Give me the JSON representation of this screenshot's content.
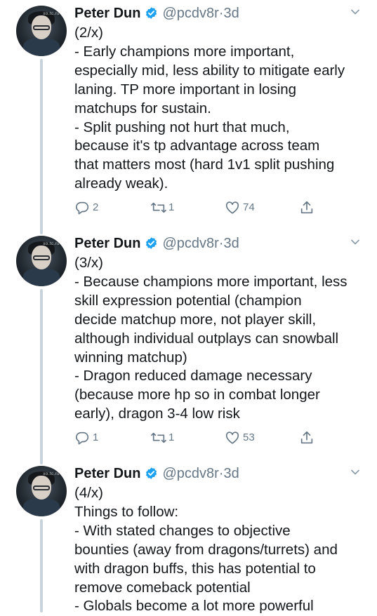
{
  "author": {
    "name": "Peter Dun",
    "handle": "@pcdv8r",
    "time_sep": "·",
    "avatar_tag": "xo.tc.ru"
  },
  "tweets": [
    {
      "time": "3d",
      "lines": [
        "(2/x)",
        "- Early champions more important,",
        "especially mid, less ability to mitigate early",
        "laning. TP more important in losing",
        "matchups for sustain.",
        "- Split pushing not hurt that much,",
        "because it's tp advantage across team",
        "that matters most (hard 1v1 split pushing",
        "already weak)."
      ],
      "replies": "2",
      "retweets": "1",
      "likes": "74"
    },
    {
      "time": "3d",
      "lines": [
        "(3/x)",
        "- Because champions more important, less",
        "skill expression potential (champion",
        "decide matchup more, not player skill,",
        "although individual outplays can snowball",
        "winning matchup)",
        "- Dragon reduced damage necessary",
        "(because more hp so in combat longer",
        "early), dragon 3-4 low risk"
      ],
      "replies": "1",
      "retweets": "1",
      "likes": "53"
    },
    {
      "time": "3d",
      "lines": [
        "(4/x)",
        "Things to follow:",
        "- With stated changes to objective",
        "bounties (away from dragons/turrets) and",
        "with dragon buffs, this has potential to",
        "remove comeback potential",
        "- Globals become a lot more powerful"
      ]
    }
  ],
  "colors": {
    "text": "#14171a",
    "secondary": "#657786",
    "verified": "#1da1f2",
    "thread_line": "#c9d3dc"
  },
  "icons": [
    "verified-badge-icon",
    "chevron-down-icon",
    "reply-icon",
    "retweet-icon",
    "like-icon",
    "share-icon"
  ]
}
